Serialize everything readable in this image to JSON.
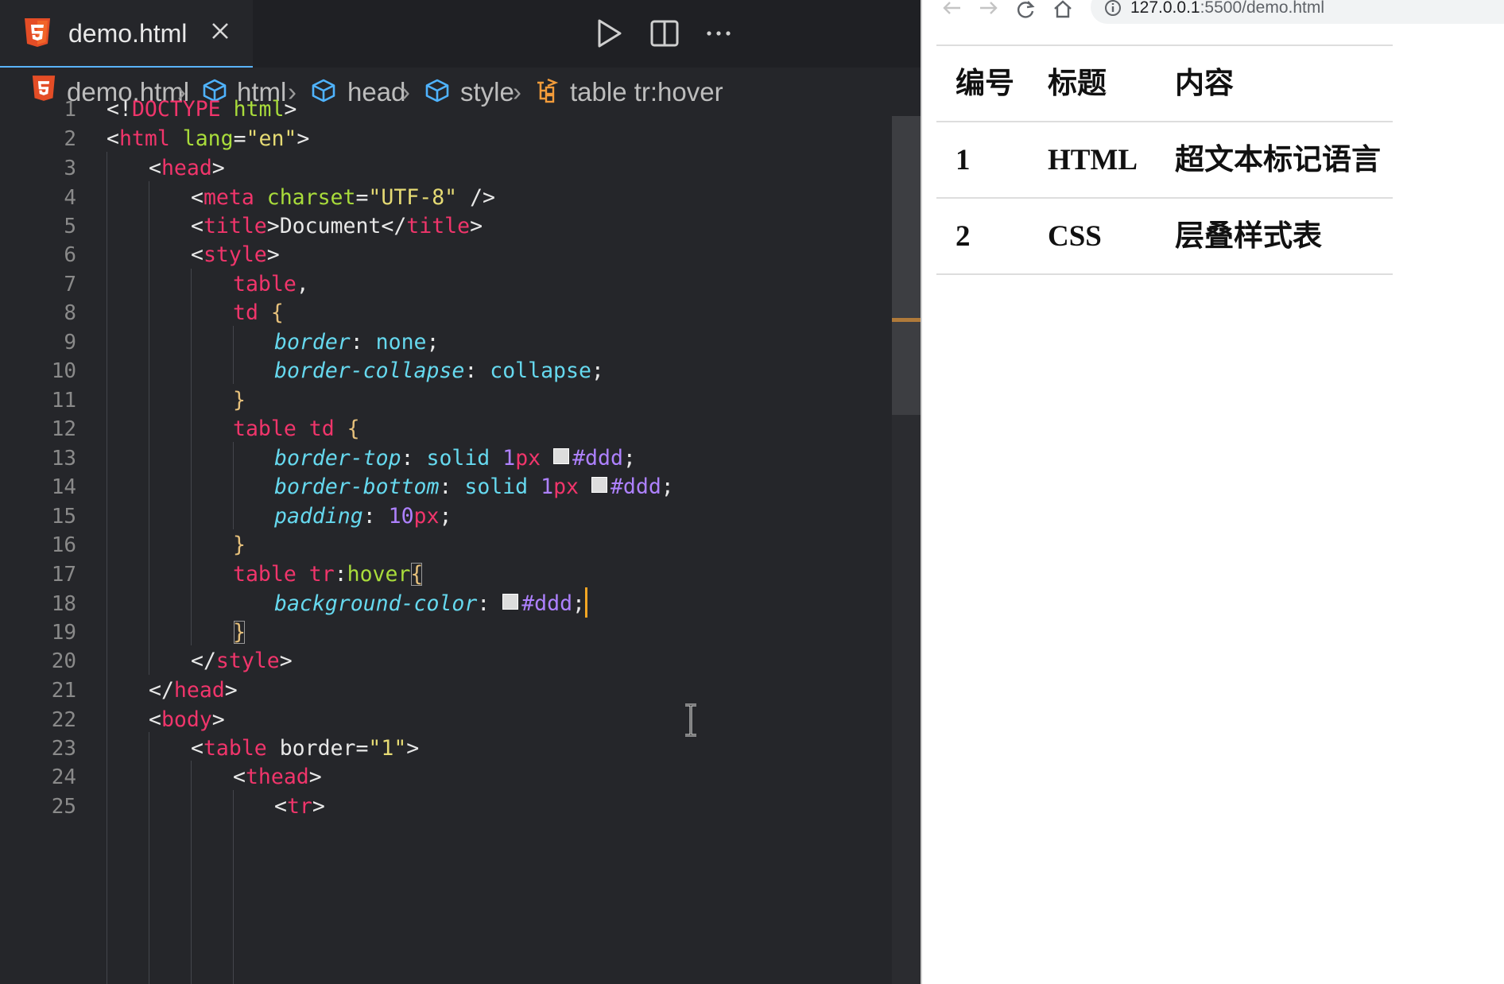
{
  "editor": {
    "tab": {
      "label": "demo.html",
      "file_icon": "html5-icon",
      "close_icon": "close-icon"
    },
    "toolbar": [
      "run-icon",
      "split-editor-icon",
      "more-icon"
    ],
    "breadcrumb": [
      "demo.html",
      "html",
      "head",
      "style",
      "table tr:hover"
    ],
    "lines": [
      {
        "n": "1"
      },
      {
        "n": "2"
      },
      {
        "n": "3"
      },
      {
        "n": "4"
      },
      {
        "n": "5"
      },
      {
        "n": "6"
      },
      {
        "n": "7"
      },
      {
        "n": "8"
      },
      {
        "n": "9"
      },
      {
        "n": "10"
      },
      {
        "n": "11"
      },
      {
        "n": "12"
      },
      {
        "n": "13"
      },
      {
        "n": "14"
      },
      {
        "n": "15"
      },
      {
        "n": "16"
      },
      {
        "n": "17"
      },
      {
        "n": "18"
      },
      {
        "n": "19"
      },
      {
        "n": "20"
      },
      {
        "n": "21"
      },
      {
        "n": "22"
      },
      {
        "n": "23"
      },
      {
        "n": "24"
      },
      {
        "n": "25"
      }
    ],
    "tokens": {
      "lt": "<",
      "gt": ">",
      "lt_slash": "</",
      "self_close": " />",
      "eq": "=",
      "bang": "!",
      "doctype": "DOCTYPE",
      "html": "html",
      "lang": "lang",
      "en": "\"en\"",
      "head": "head",
      "meta": "meta",
      "charset": "charset",
      "utf8": "\"UTF-8\"",
      "title": "title",
      "document": "Document",
      "style": "style",
      "table": "table",
      "td": "td",
      "tr": "tr",
      "hover": "hover",
      "comma": ",",
      "colon": ":",
      "semi": ";",
      "brace_open": "{",
      "brace_close": "}",
      "border": "border",
      "none": "none",
      "border_collapse": "border-collapse",
      "collapse": "collapse",
      "border_top": "border-top",
      "border_bottom": "border-bottom",
      "solid": "solid",
      "one": "1",
      "px": "px",
      "ddd": "#ddd",
      "padding": "padding",
      "ten": "10",
      "background_color": "background-color",
      "body": "body",
      "border_attr": "border",
      "one_str": "\"1\"",
      "thead": "thead"
    },
    "accent": {
      "tag": "#f0356b",
      "attr": "#a9dc3b",
      "string": "#e6db74",
      "property": "#66d9ef",
      "number": "#ae81ff",
      "swatch": "#dddddd",
      "cursor": "#f5a623"
    }
  },
  "browser": {
    "nav_icons": [
      "back-icon",
      "forward-icon",
      "reload-icon",
      "home-icon",
      "info-icon"
    ],
    "url": {
      "host": "127.0.0.1",
      "path": ":5500/demo.html"
    },
    "table": {
      "headers": [
        "编号",
        "标题",
        "内容"
      ],
      "rows": [
        [
          "1",
          "HTML",
          "超文本标记语言"
        ],
        [
          "2",
          "CSS",
          "层叠样式表"
        ]
      ]
    }
  }
}
